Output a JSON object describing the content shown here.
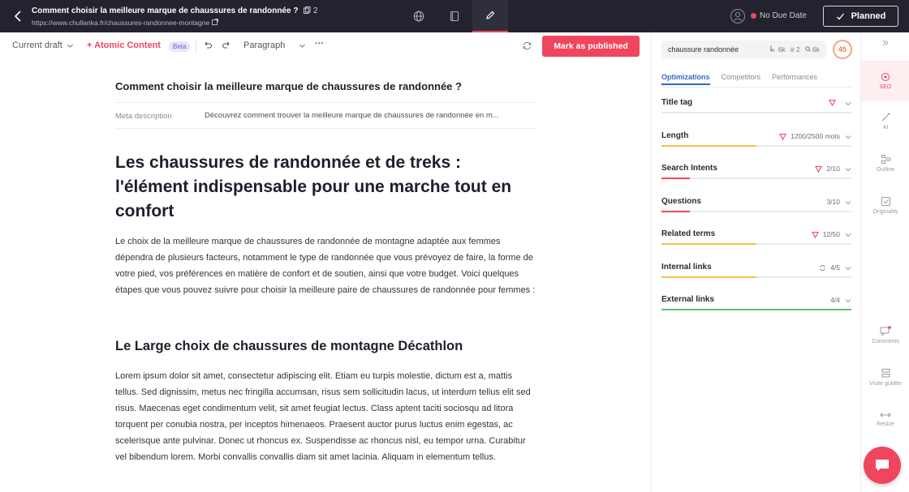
{
  "topbar": {
    "title": "Comment choisir la meilleure marque de chaussures de randonnée ?",
    "copies": "2",
    "url": "https://www.chullanka.fr/chaussures-randonnee-montagne",
    "due_date": "No Due Date",
    "planned": "Planned"
  },
  "toolbar": {
    "draft": "Current draft",
    "atomic": "+ Atomic Content",
    "beta": "Beta",
    "paragraph": "Paragraph",
    "more": "···",
    "publish": "Mark as published"
  },
  "editor": {
    "title": "Comment choisir la meilleure marque de chaussures de randonnée ?",
    "meta_label": "Meta description",
    "meta_text": "Découvrez comment trouver la meilleure marque de chaussures de randonnée en m...",
    "h1": "Les chaussures de randonnée et de treks : l'élément indispensable pour une marche tout en confort",
    "p1": "Le choix de la meilleure marque de chaussures de randonnée de montagne adaptée aux femmes dépendra de plusieurs facteurs, notamment le type de randonnée que vous prévoyez de faire, la forme de votre pied, vos préférences en matière de confort et de soutien, ainsi que votre budget. Voici quelques étapes que vous pouvez suivre pour choisir la meilleure paire de chaussures de randonnée pour femmes :",
    "h2": "Le Large choix de chaussures de montagne Décathlon",
    "p2": "Lorem ipsum dolor sit amet, consectetur adipiscing elit. Etiam eu turpis molestie, dictum est a, mattis tellus. Sed dignissim, metus nec fringilla accumsan, risus sem sollicitudin lacus, ut interdum tellus elit sed risus. Maecenas eget condimentum velit, sit amet feugiat lectus. Class aptent taciti sociosqu ad litora torquent per conubia nostra, per inceptos himenaeos. Praesent auctor purus luctus enim egestas, ac scelerisque ante pulvinar. Donec ut rhoncus ex. Suspendisse ac rhoncus nisl, eu tempor urna. Curabitur vel bibendum lorem. Morbi convallis convallis diam sit amet lacinia. Aliquam in elementum tellus."
  },
  "seo": {
    "keyword": "chaussure randonnée",
    "kw_stat1": "6k",
    "kw_stat2": "2",
    "kw_stat3": "6k",
    "score": "45",
    "tabs": [
      "Optimizations",
      "Competitors",
      "Performances"
    ],
    "rows": [
      {
        "label": "Title tag",
        "value": "",
        "progress": 0,
        "color": "#f0455f"
      },
      {
        "label": "Length",
        "value": "1200/2500 mots",
        "progress": 0.5,
        "color": "#f2c14e"
      },
      {
        "label": "Search Intents",
        "value": "2/10",
        "progress": 0.15,
        "color": "#f0455f"
      },
      {
        "label": "Questions",
        "value": "3/10",
        "progress": 0.15,
        "color": "#f0455f"
      },
      {
        "label": "Related terms",
        "value": "12/50",
        "progress": 0.5,
        "color": "#f2c14e"
      },
      {
        "label": "Internal links",
        "value": "4/5",
        "progress": 0.5,
        "color": "#f2c14e"
      },
      {
        "label": "External links",
        "value": "4/4",
        "progress": 1.0,
        "color": "#5cc476"
      }
    ]
  },
  "rail": {
    "seo": "SEO",
    "ai": "AI",
    "outline": "Outline",
    "originality": "Originality",
    "comments": "Comments",
    "visite": "Visite guidée",
    "resize": "Resize"
  },
  "colors": {
    "accent": "#f0455f",
    "topbar": "#23232f",
    "link": "#3566c2"
  }
}
